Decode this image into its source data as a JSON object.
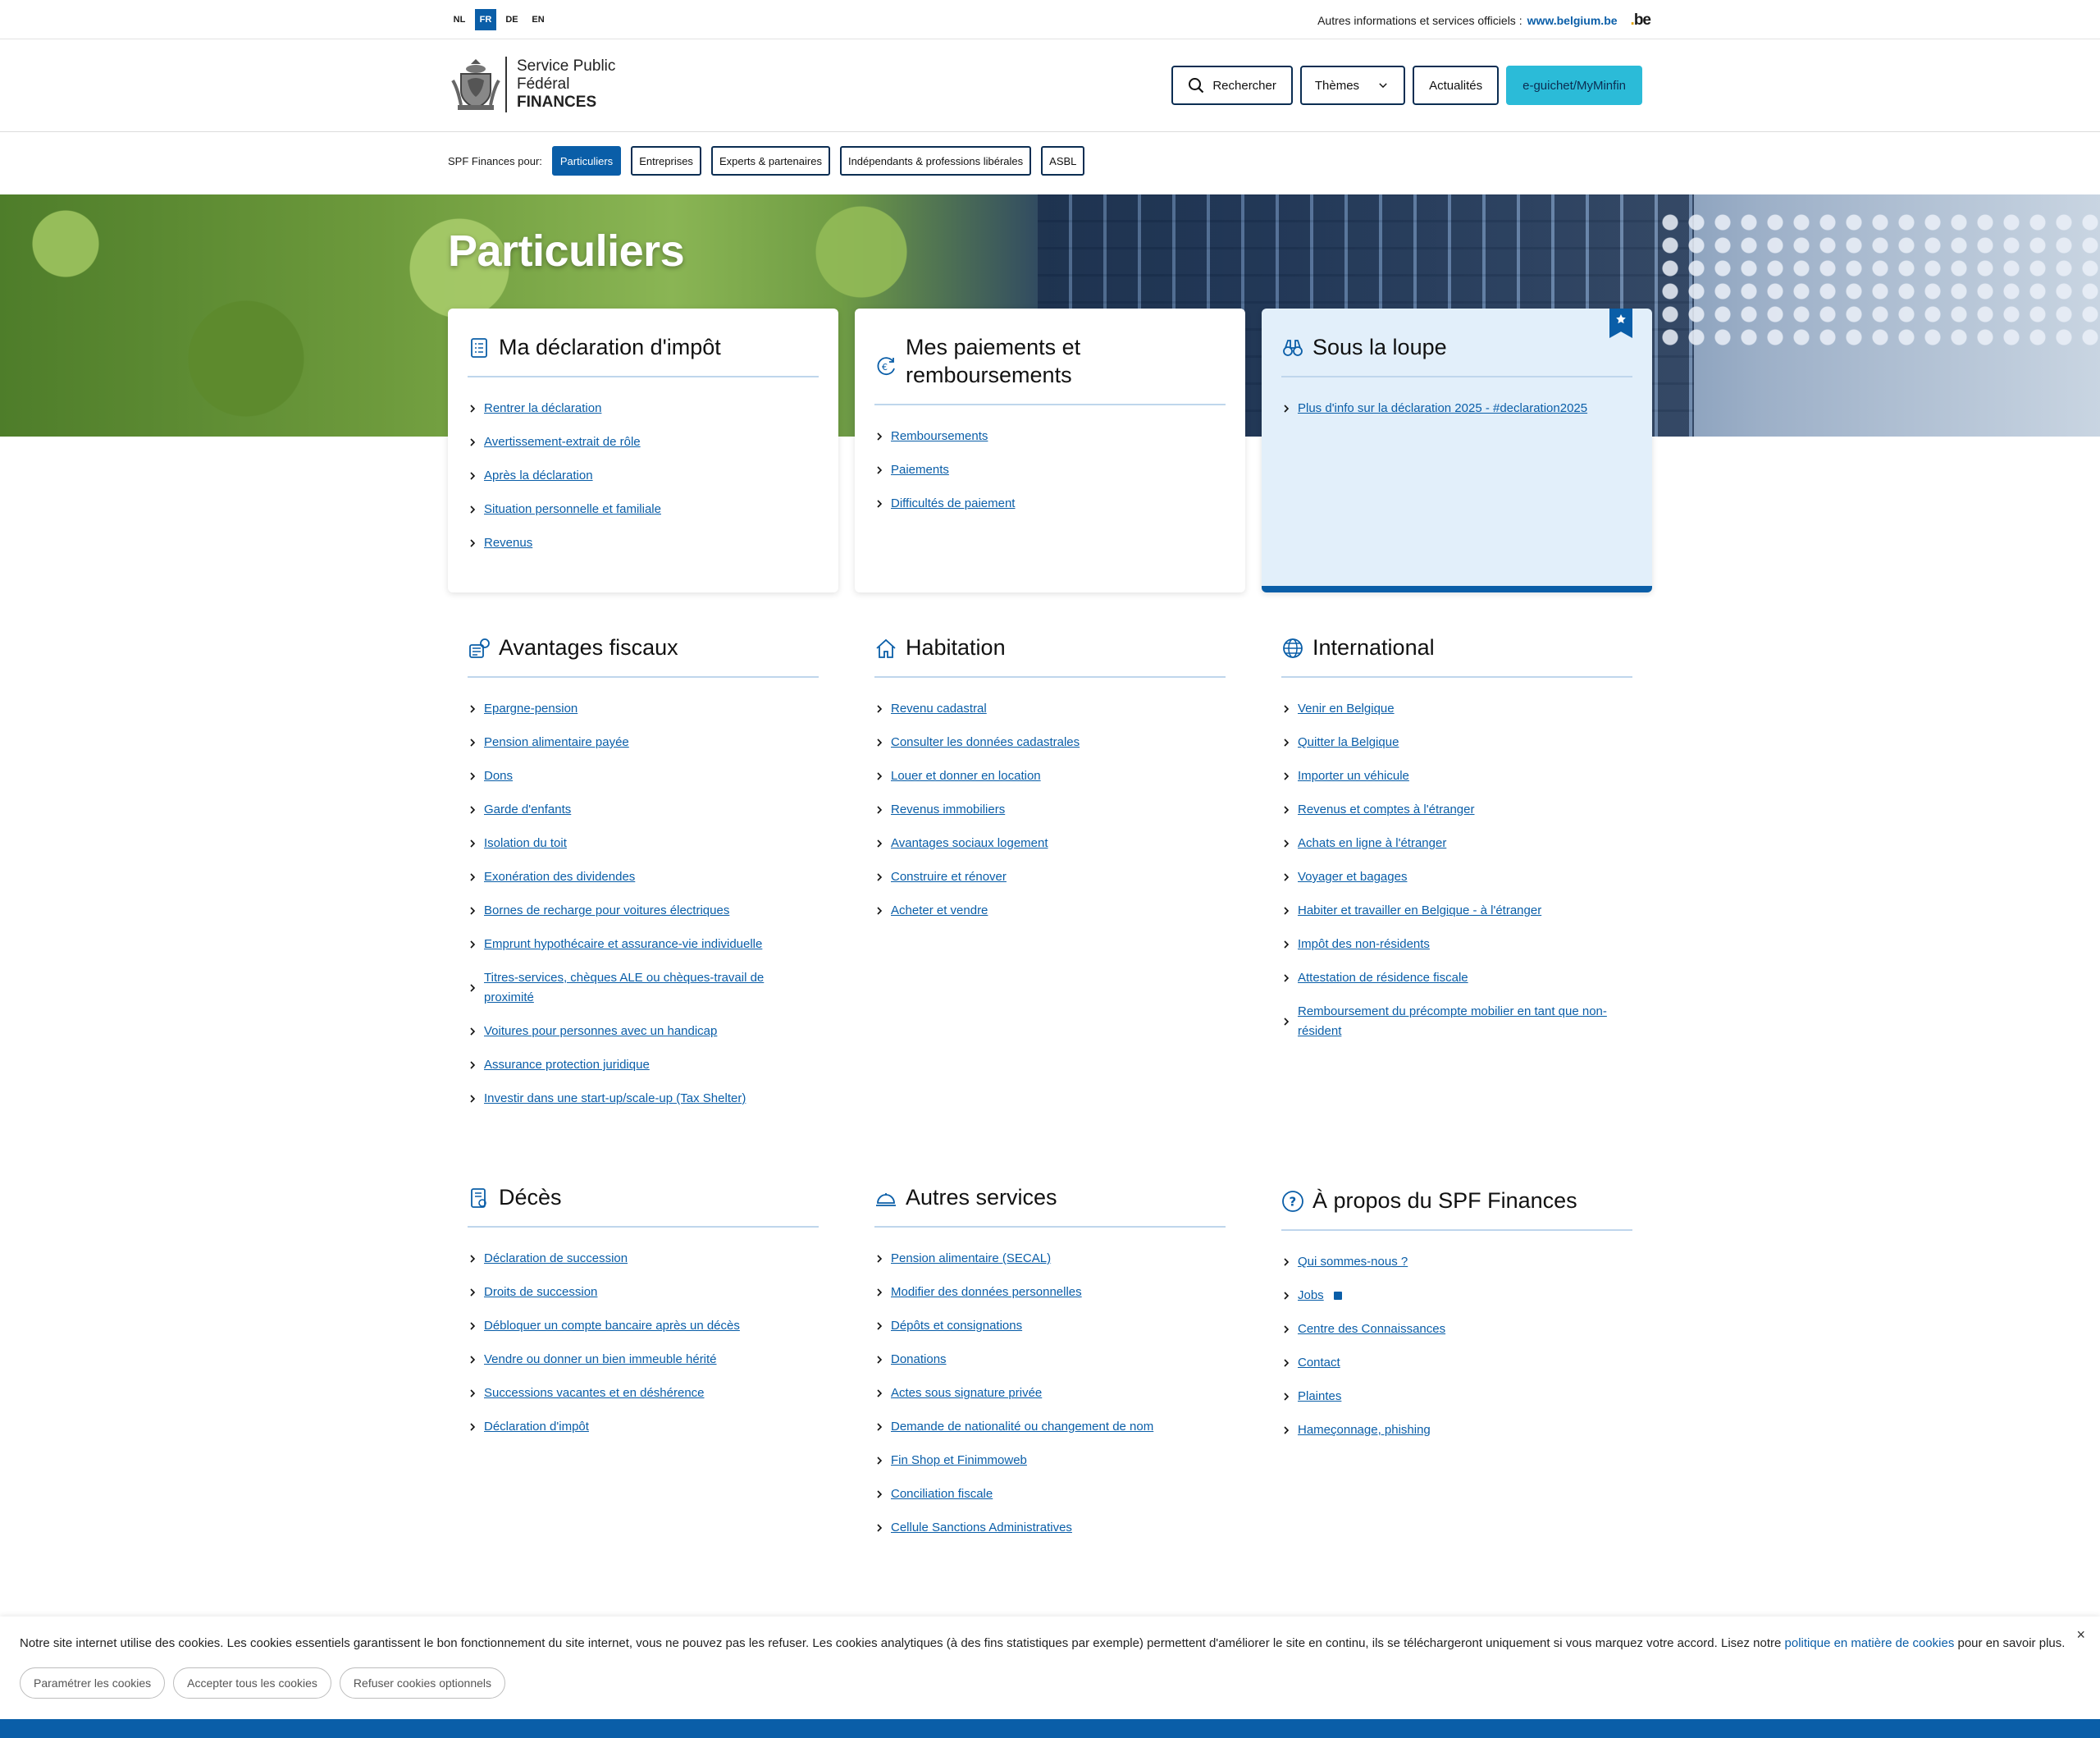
{
  "languages": [
    {
      "code": "NL",
      "active": false
    },
    {
      "code": "FR",
      "active": true
    },
    {
      "code": "DE",
      "active": false
    },
    {
      "code": "EN",
      "active": false
    }
  ],
  "official": {
    "text": "Autres informations et services officiels :",
    "link": "www.belgium.be",
    "logo": "be"
  },
  "logo": {
    "line1": "Service Public",
    "line2": "Fédéral",
    "line3": "FINANCES"
  },
  "nav": {
    "search": "Rechercher",
    "themes": "Thèmes",
    "news": "Actualités",
    "eguichet": "e-guichet/MyMinfin"
  },
  "audience": {
    "label": "SPF Finances pour:",
    "items": [
      "Particuliers",
      "Entreprises",
      "Experts & partenaires",
      "Indépendants & professions libérales",
      "ASBL"
    ]
  },
  "hero": {
    "title": "Particuliers"
  },
  "cards": {
    "declaration": {
      "title": "Ma déclaration d'impôt",
      "icon": "document-list-icon",
      "links": [
        "Rentrer la déclaration",
        "Avertissement-extrait de rôle",
        "Après la déclaration",
        "Situation personnelle et familiale",
        "Revenus"
      ]
    },
    "paiements": {
      "title": "Mes paiements et remboursements",
      "icon": "euro-refresh-icon",
      "links": [
        "Remboursements",
        "Paiements",
        "Difficultés de paiement"
      ]
    },
    "loupe": {
      "title": "Sous la loupe",
      "icon": "binoculars-icon",
      "links": [
        "Plus d'info sur la déclaration 2025 - #declaration2025"
      ]
    }
  },
  "sections": {
    "avantages": {
      "title": "Avantages fiscaux",
      "icon": "piggy-bank-icon",
      "links": [
        "Epargne-pension",
        "Pension alimentaire payée",
        "Dons",
        "Garde d'enfants",
        "Isolation du toit",
        "Exonération des dividendes",
        "Bornes de recharge pour voitures électriques",
        "Emprunt hypothécaire et assurance-vie individuelle",
        "Titres-services, chèques ALE ou chèques-travail de proximité",
        "Voitures pour personnes avec un handicap",
        "Assurance protection juridique",
        "Investir dans une start-up/scale-up (Tax Shelter)"
      ]
    },
    "habitation": {
      "title": "Habitation",
      "icon": "house-icon",
      "links": [
        "Revenu cadastral",
        "Consulter les données cadastrales",
        "Louer et donner en location",
        "Revenus immobiliers",
        "Avantages sociaux logement",
        "Construire et rénover",
        "Acheter et vendre"
      ]
    },
    "international": {
      "title": "International",
      "icon": "globe-icon",
      "links": [
        "Venir en Belgique",
        "Quitter la Belgique",
        "Importer un véhicule",
        "Revenus et comptes à l'étranger",
        "Achats en ligne à l'étranger",
        "Voyager et bagages",
        "Habiter et travailler en Belgique - à l'étranger",
        "Impôt des non-résidents",
        "Attestation de résidence fiscale",
        "Remboursement du précompte mobilier en tant que non-résident"
      ]
    },
    "deces": {
      "title": "Décès",
      "icon": "certificate-icon",
      "links": [
        "Déclaration de succession",
        "Droits de succession",
        "Débloquer un compte bancaire après un décès",
        "Vendre ou donner un bien immeuble hérité",
        "Successions vacantes et en déshérence",
        "Déclaration d'impôt"
      ]
    },
    "autres": {
      "title": "Autres services",
      "icon": "service-bell-icon",
      "links": [
        "Pension alimentaire (SECAL)",
        "Modifier des données personnelles",
        "Dépôts et consignations",
        "Donations",
        "Actes sous signature privée",
        "Demande de nationalité ou changement de nom",
        "Fin Shop et Finimmoweb",
        "Conciliation fiscale",
        "Cellule Sanctions Administratives"
      ]
    },
    "apropos": {
      "title": "À propos du SPF Finances",
      "icon": "question-circle-icon",
      "links": [
        "Qui sommes-nous ?",
        "Jobs",
        "Centre des Connaissances",
        "Contact",
        "Plaintes",
        "Hameçonnage, phishing"
      ]
    }
  },
  "cookie": {
    "text_before": "Notre site internet utilise des cookies. Les cookies essentiels garantissent le bon fonctionnement du site internet, vous ne pouvez pas les refuser. Les cookies analytiques (à des fins statistiques par exemple) permettent d'améliorer le site en continu, ils se téléchargeront uniquement si vous marquez votre accord. Lisez notre",
    "link": "politique en matière de cookies",
    "text_after": "pour en savoir plus.",
    "close": "×",
    "buttons": [
      "Paramétrer les cookies",
      "Accepter tous les cookies",
      "Refuser cookies optionnels"
    ]
  },
  "colors": {
    "primary": "#0a5ea8",
    "accent": "#2bbbd8",
    "navy": "#0b2d52",
    "feature_bg": "#e2effa"
  }
}
